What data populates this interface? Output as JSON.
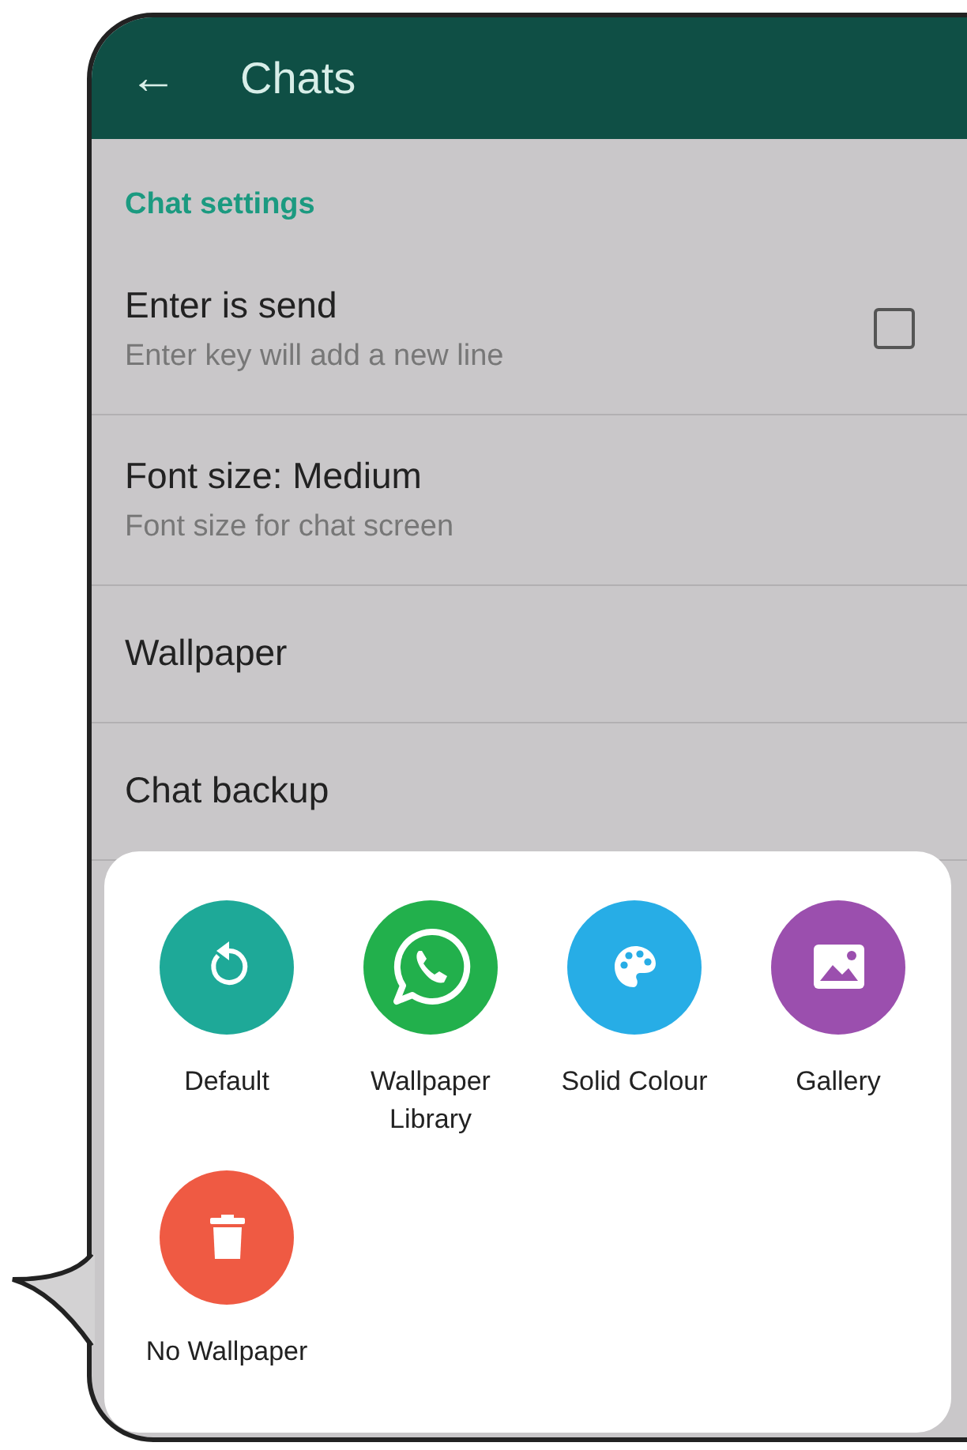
{
  "header": {
    "back": "←",
    "title": "Chats"
  },
  "section": "Chat settings",
  "settings": [
    {
      "kind": "checkbox",
      "title": "Enter is send",
      "subtitle": "Enter key will add a new line",
      "checked": false
    },
    {
      "kind": "text",
      "title": "Font size: Medium",
      "subtitle": "Font size for chat screen"
    },
    {
      "kind": "text",
      "title": "Wallpaper"
    },
    {
      "kind": "text",
      "title": "Chat backup"
    }
  ],
  "wallpaper_options": [
    {
      "kind": "reset",
      "label": "Default",
      "color": "#1ea998"
    },
    {
      "kind": "library",
      "label": "Wallpaper Library",
      "color": "#22b04c"
    },
    {
      "kind": "palette",
      "label": "Solid Colour",
      "color": "#27ade6"
    },
    {
      "kind": "gallery",
      "label": "Gallery",
      "color": "#9b4fae"
    },
    {
      "kind": "delete",
      "label": "No Wallpaper",
      "color": "#ef5a43"
    }
  ]
}
